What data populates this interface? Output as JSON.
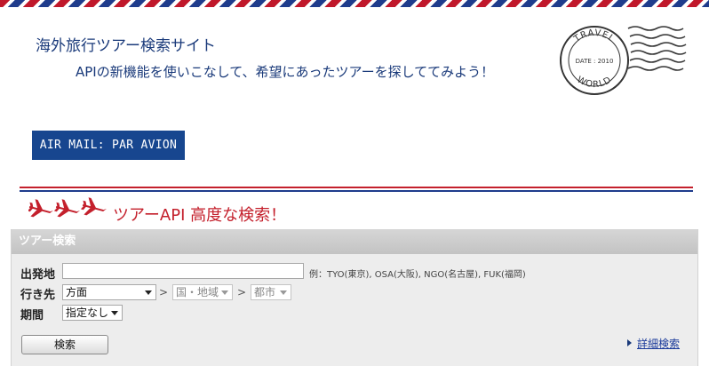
{
  "header": {
    "title": "海外旅行ツアー検索サイト",
    "subtitle": "APIの新機能を使いこなして、希望にあったツアーを探しててみよう！",
    "badge": "AIR MAIL: PAR AVION"
  },
  "stamp": {
    "top_text": "TRAVEL",
    "date_text": "DATE : 2010",
    "bottom_text": "WORLD"
  },
  "section": {
    "heading": "ツアーAPI 高度な検索！",
    "icon": "airplane-icon"
  },
  "panel": {
    "title": "ツアー検索",
    "origin": {
      "label": "出発地",
      "value": "",
      "hint": "例：TYO(東京), OSA(大阪), NGO(名古屋), FUK(福岡)"
    },
    "destination": {
      "label": "行き先",
      "area": "方面",
      "country": "国・地域",
      "city": "都市",
      "separator": ">"
    },
    "period": {
      "label": "期間",
      "value": "指定なし"
    },
    "search_label": "検索",
    "advanced_label": "詳細検索"
  },
  "colors": {
    "red": "#c4202c",
    "blue": "#1f3c8c",
    "badge_bg": "#17468f",
    "title_text": "#1a3a7a"
  }
}
